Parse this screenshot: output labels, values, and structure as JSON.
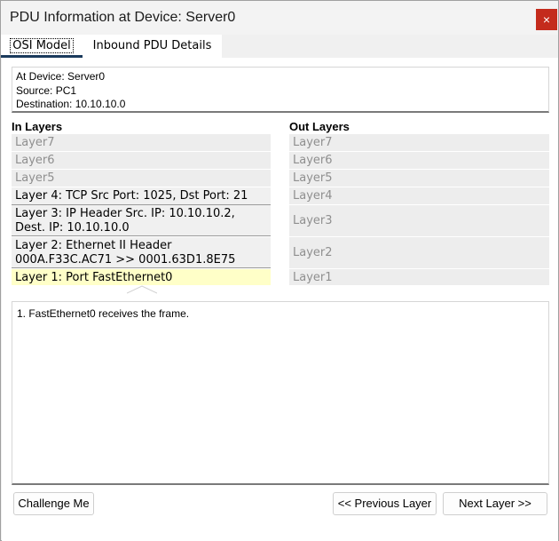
{
  "window": {
    "title": "PDU Information at Device: Server0",
    "close_label": "×"
  },
  "tabs": [
    {
      "label": "OSI Model",
      "selected": true
    },
    {
      "label": "Inbound PDU Details",
      "selected": false
    }
  ],
  "info": {
    "device_line": "At Device: Server0",
    "source_line": "Source: PC1",
    "destination_line": "Destination: 10.10.10.0"
  },
  "in_layers": {
    "header": "In Layers",
    "items": [
      {
        "line1": "Layer7",
        "line2": ""
      },
      {
        "line1": "Layer6",
        "line2": ""
      },
      {
        "line1": "Layer5",
        "line2": ""
      },
      {
        "line1": "Layer 4: TCP Src Port: 1025, Dst Port: 21",
        "line2": ""
      },
      {
        "line1": "Layer 3: IP Header Src. IP: 10.10.10.2,",
        "line2": "Dest. IP: 10.10.10.0"
      },
      {
        "line1": "Layer 2: Ethernet II Header",
        "line2": "000A.F33C.AC71 >> 0001.63D1.8E75"
      },
      {
        "line1": "Layer 1: Port FastEthernet0",
        "line2": ""
      }
    ]
  },
  "out_layers": {
    "header": "Out Layers",
    "items": [
      "Layer7",
      "Layer6",
      "Layer5",
      "Layer4",
      "Layer3",
      "Layer2",
      "Layer1"
    ]
  },
  "description": {
    "text": "1. FastEthernet0 receives the frame."
  },
  "buttons": {
    "challenge": "Challenge Me",
    "previous": "<< Previous Layer",
    "next": "Next Layer >>"
  },
  "colors": {
    "close_bg": "#c42b1c",
    "selected_layer_bg": "#ffffc8",
    "tab_underline": "#1a3a5c"
  }
}
